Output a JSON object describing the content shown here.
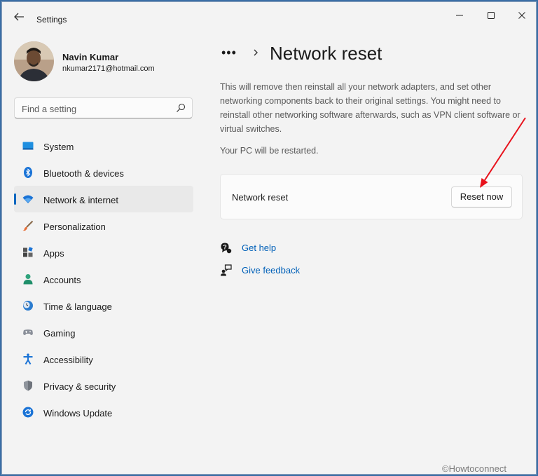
{
  "window": {
    "title": "Settings"
  },
  "user": {
    "name": "Navin Kumar",
    "email": "nkumar2171@hotmail.com"
  },
  "search": {
    "placeholder": "Find a setting"
  },
  "sidebar": {
    "items": [
      {
        "label": "System",
        "icon": "system-icon"
      },
      {
        "label": "Bluetooth & devices",
        "icon": "bluetooth-icon"
      },
      {
        "label": "Network & internet",
        "icon": "wifi-icon",
        "active": true
      },
      {
        "label": "Personalization",
        "icon": "brush-icon"
      },
      {
        "label": "Apps",
        "icon": "apps-icon"
      },
      {
        "label": "Accounts",
        "icon": "person-icon"
      },
      {
        "label": "Time & language",
        "icon": "clock-globe-icon"
      },
      {
        "label": "Gaming",
        "icon": "gamepad-icon"
      },
      {
        "label": "Accessibility",
        "icon": "accessibility-icon"
      },
      {
        "label": "Privacy & security",
        "icon": "shield-icon"
      },
      {
        "label": "Windows Update",
        "icon": "update-icon"
      }
    ]
  },
  "header": {
    "breadcrumb_more": "•••",
    "title": "Network reset"
  },
  "main": {
    "description": "This will remove then reinstall all your network adapters, and set other networking components back to their original settings. You might need to reinstall other networking software afterwards, such as VPN client software or virtual switches.",
    "restart_note": "Your PC will be restarted.",
    "card": {
      "label": "Network reset",
      "button_label": "Reset now"
    },
    "links": [
      {
        "label": "Get help",
        "icon": "help-icon"
      },
      {
        "label": "Give feedback",
        "icon": "feedback-icon"
      }
    ]
  },
  "colors": {
    "accent": "#0067c0",
    "link": "#0060b8",
    "annotation_arrow": "#e8121c"
  },
  "watermark": "©Howtoconnect"
}
